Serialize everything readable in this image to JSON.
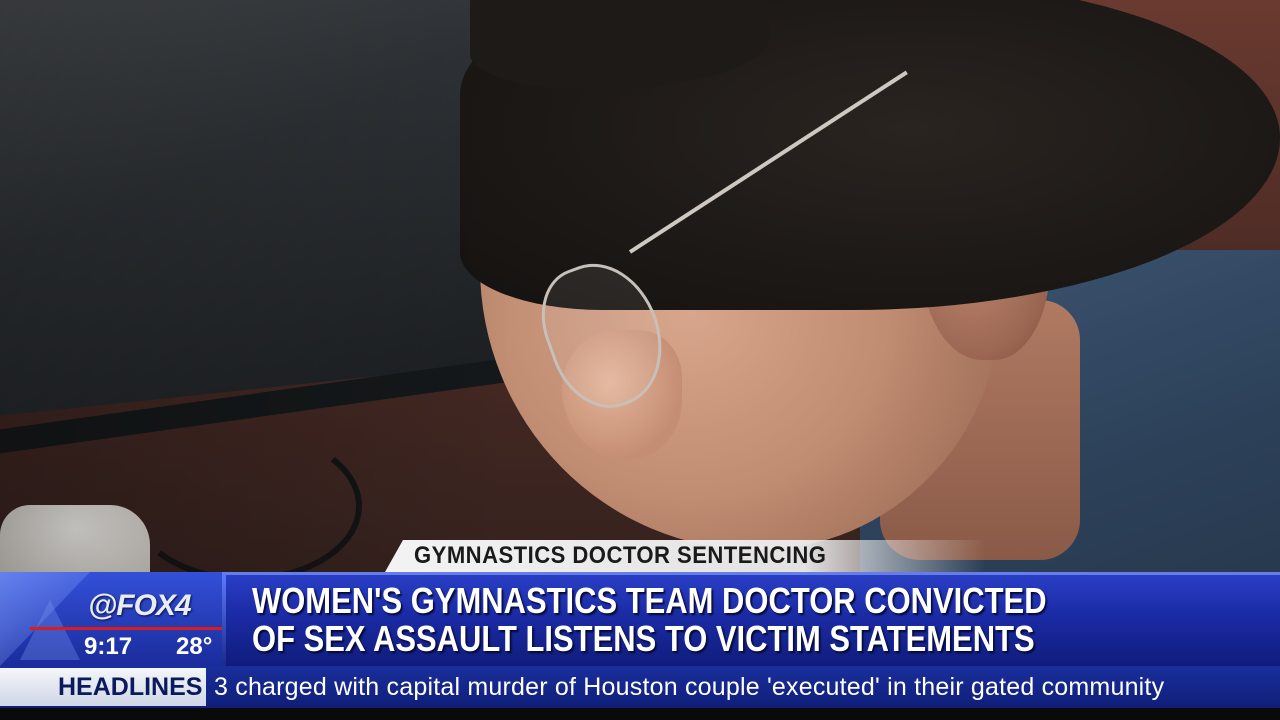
{
  "topic_tab": "GYMNASTICS DOCTOR SENTENCING",
  "logo": {
    "text": "@FOX4"
  },
  "clock": {
    "time": "9:17",
    "temperature": "28°"
  },
  "headline": {
    "line1": "WOMEN'S GYMNASTICS TEAM DOCTOR CONVICTED",
    "line2": "OF SEX ASSAULT LISTENS TO VICTIM STATEMENTS"
  },
  "ticker": {
    "label": "HEADLINES",
    "text": "3 charged with capital murder of Houston couple 'executed' in their gated community"
  },
  "colors": {
    "band": "#1b2ba6",
    "ticker": "#0f1e78",
    "accent_red": "#d91c1c"
  }
}
